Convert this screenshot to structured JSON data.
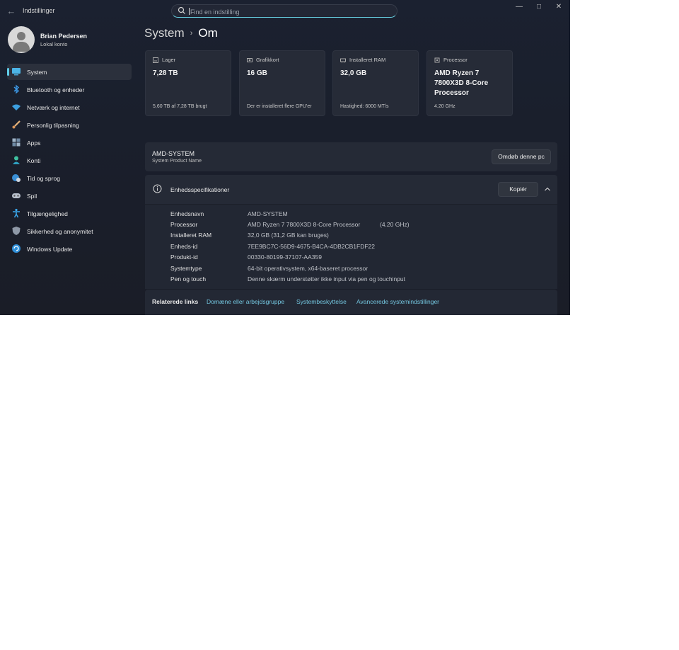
{
  "window": {
    "title": "Indstillinger",
    "search_placeholder": "Find en indstilling"
  },
  "profile": {
    "name": "Brian Pedersen",
    "account": "Lokal konto"
  },
  "sidebar": {
    "items": [
      {
        "label": "System",
        "icon": "monitor-icon",
        "active": true
      },
      {
        "label": "Bluetooth og enheder",
        "icon": "bluetooth-icon"
      },
      {
        "label": "Netværk og internet",
        "icon": "wifi-icon"
      },
      {
        "label": "Personlig tilpasning",
        "icon": "brush-icon"
      },
      {
        "label": "Apps",
        "icon": "apps-icon"
      },
      {
        "label": "Konti",
        "icon": "person-icon"
      },
      {
        "label": "Tid og sprog",
        "icon": "globe-clock-icon"
      },
      {
        "label": "Spil",
        "icon": "gamepad-icon"
      },
      {
        "label": "Tilgængelighed",
        "icon": "accessibility-icon"
      },
      {
        "label": "Sikkerhed og anonymitet",
        "icon": "shield-icon"
      },
      {
        "label": "Windows Update",
        "icon": "update-icon"
      }
    ]
  },
  "breadcrumb": {
    "parent": "System",
    "separator": "›",
    "current": "Om"
  },
  "cards": [
    {
      "label": "Lager",
      "value": "7,28 TB",
      "sub": "5,60 TB af 7,28 TB brugt",
      "icon": "storage-icon"
    },
    {
      "label": "Grafikkort",
      "value": "16 GB",
      "sub": "Der er installeret flere GPU'er",
      "icon": "gpu-icon"
    },
    {
      "label": "Installeret RAM",
      "value": "32,0 GB",
      "sub": "Hastighed: 6000 MT/s",
      "icon": "ram-icon"
    },
    {
      "label": "Processor",
      "value": "AMD Ryzen 7 7800X3D 8-Core Processor",
      "sub": "4.20 GHz",
      "icon": "cpu-icon"
    }
  ],
  "device": {
    "name": "AMD-SYSTEM",
    "sub": "System Product Name",
    "rename_label": "Omdøb denne pc"
  },
  "specs": {
    "title": "Enhedsspecifikationer",
    "copy_label": "Kopiér",
    "rows": [
      {
        "label": "Enhedsnavn",
        "value": "AMD-SYSTEM"
      },
      {
        "label": "Processor",
        "value": "AMD Ryzen 7 7800X3D 8-Core Processor",
        "extra": "(4.20 GHz)"
      },
      {
        "label": "Installeret RAM",
        "value": "32,0 GB (31,2 GB kan bruges)"
      },
      {
        "label": "Enheds-id",
        "value": "7EE9BC7C-56D9-4675-B4CA-4DB2CB1FDF22"
      },
      {
        "label": "Produkt-id",
        "value": "00330-80199-37107-AA359"
      },
      {
        "label": "Systemtype",
        "value": "64-bit operativsystem, x64-baseret processor"
      },
      {
        "label": "Pen og touch",
        "value": "Denne skærm understøtter ikke input via pen og touchinput"
      }
    ]
  },
  "related": {
    "title": "Relaterede links",
    "links": [
      "Domæne eller arbejdsgruppe",
      "Systembeskyttelse",
      "Avancerede systemindstillinger"
    ]
  },
  "colors": {
    "accent": "#60cde8",
    "link": "#74c7e0",
    "background": "#1b2030",
    "card": "#262b37"
  }
}
